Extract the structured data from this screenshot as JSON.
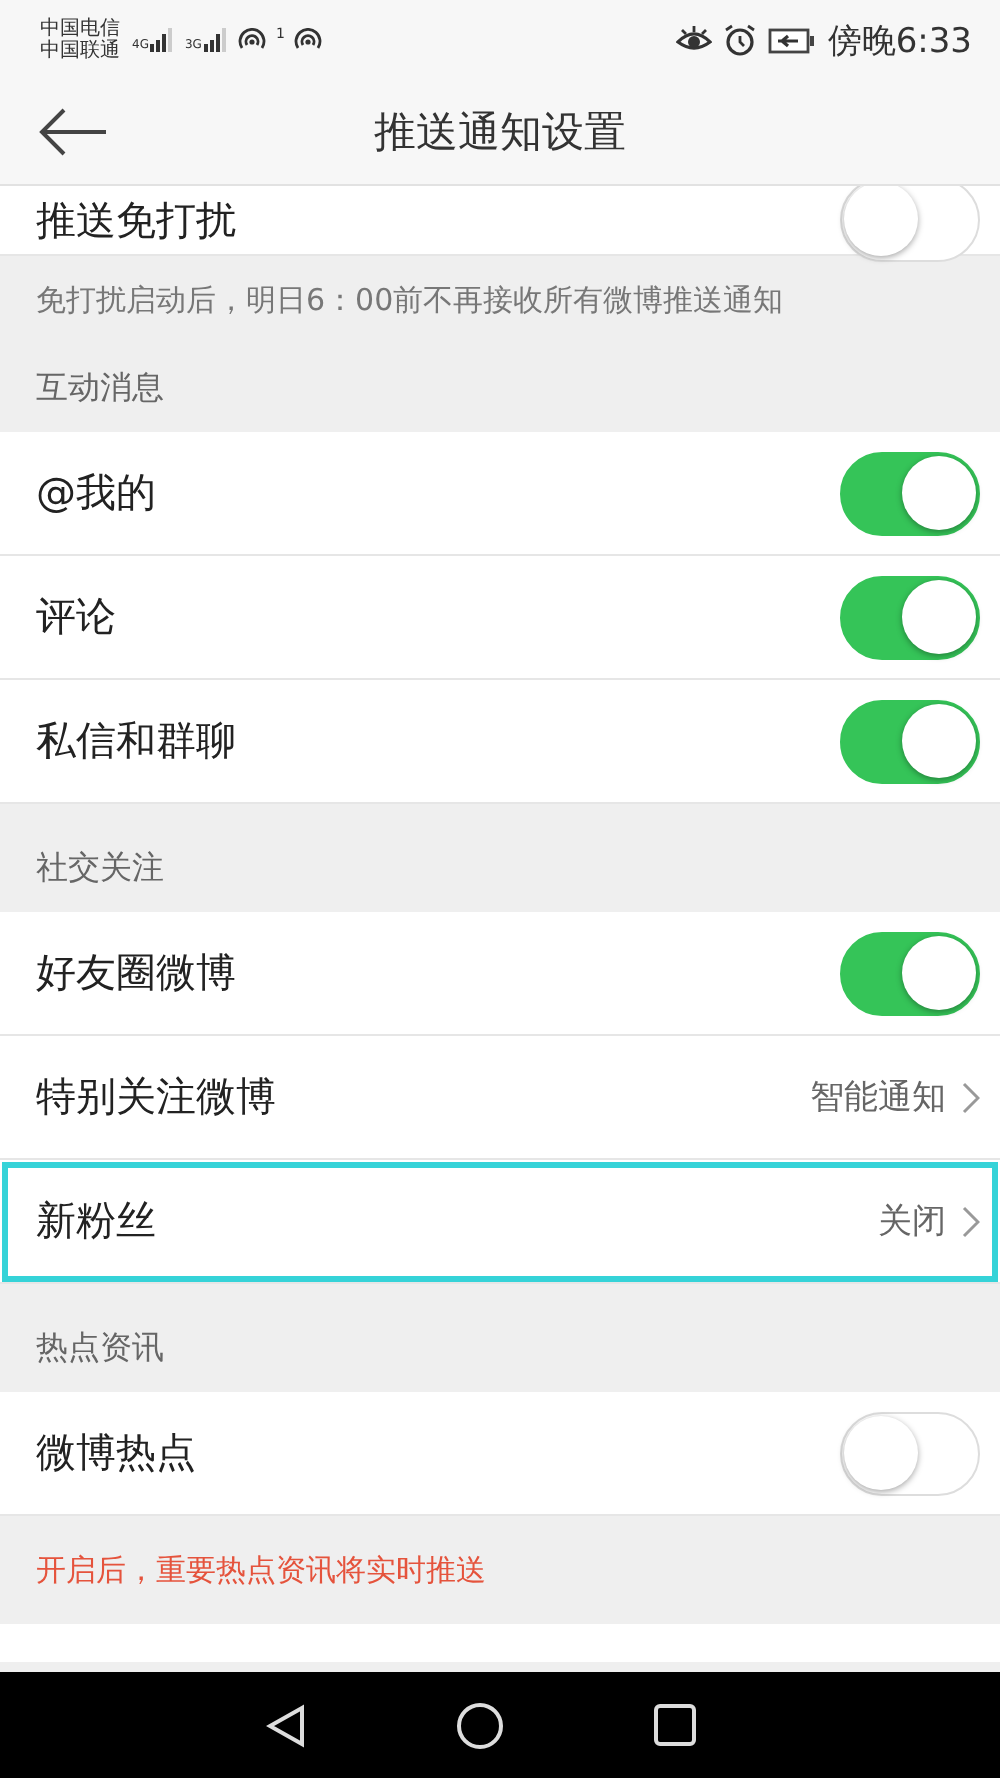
{
  "status_bar": {
    "carriers": [
      "中国电信",
      "中国联通"
    ],
    "networks": [
      "4G",
      "3G"
    ],
    "hotspot_count": "1",
    "time": "傍晚6:33"
  },
  "header": {
    "title": "推送通知设置"
  },
  "items": [
    {
      "kind": "toggle",
      "label": "推送免打扰",
      "on": false,
      "highlighted": false,
      "cut": true
    },
    {
      "kind": "note",
      "text": "免打扰启动后，明日6：00前不再接收所有微博推送通知",
      "warning": false
    },
    {
      "kind": "section",
      "text": "互动消息"
    },
    {
      "kind": "toggle",
      "label": "@我的",
      "on": true,
      "highlighted": false
    },
    {
      "kind": "toggle",
      "label": "评论",
      "on": true,
      "highlighted": false
    },
    {
      "kind": "toggle",
      "label": "私信和群聊",
      "on": true,
      "highlighted": false
    },
    {
      "kind": "section",
      "text": "社交关注"
    },
    {
      "kind": "toggle",
      "label": "好友圈微博",
      "on": true,
      "highlighted": false
    },
    {
      "kind": "link",
      "label": "特别关注微博",
      "value": "智能通知",
      "highlighted": false
    },
    {
      "kind": "link",
      "label": "新粉丝",
      "value": "关闭",
      "highlighted": true
    },
    {
      "kind": "section",
      "text": "热点资讯"
    },
    {
      "kind": "toggle",
      "label": "微博热点",
      "on": false,
      "highlighted": false
    },
    {
      "kind": "note",
      "text": "开启后，重要热点资讯将实时推送",
      "warning": true
    }
  ]
}
